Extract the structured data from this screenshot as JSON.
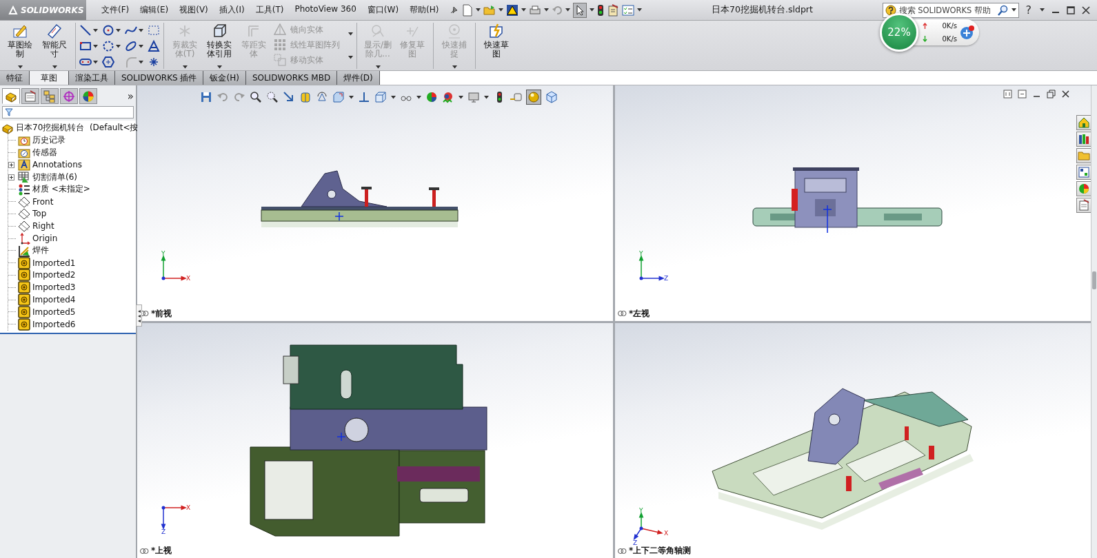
{
  "window": {
    "title": "日本70挖掘机转台.sldprt"
  },
  "app": {
    "name": "SOLIDWORKS"
  },
  "menu": [
    "文件(F)",
    "编辑(E)",
    "视图(V)",
    "插入(I)",
    "工具(T)",
    "PhotoView 360",
    "窗口(W)",
    "帮助(H)"
  ],
  "search": {
    "placeholder": "搜索 SOLIDWORKS 帮助"
  },
  "help": "?",
  "net_monitor": {
    "percent": "22%",
    "upload": "0K/s",
    "download": "0K/s"
  },
  "ribbon": [
    {
      "kind": "big",
      "label": "草图绘制",
      "disabled": false,
      "dropdown": true
    },
    {
      "kind": "big",
      "label": "智能尺寸",
      "disabled": false,
      "dropdown": true
    },
    {
      "kind": "separator"
    },
    {
      "kind": "tools"
    },
    {
      "kind": "separator"
    },
    {
      "kind": "big",
      "label": "剪裁实体(T)",
      "disabled": true,
      "dropdown": true
    },
    {
      "kind": "big",
      "label": "转换实体引用",
      "disabled": false,
      "dropdown": true
    },
    {
      "kind": "big",
      "label": "等距实体",
      "disabled": true,
      "dropdown": false
    },
    {
      "kind": "list",
      "items": [
        {
          "label": "镜向实体",
          "disabled": true
        },
        {
          "label": "线性草图阵列",
          "disabled": true
        },
        {
          "label": "移动实体",
          "disabled": true
        }
      ]
    },
    {
      "kind": "separator"
    },
    {
      "kind": "big",
      "label": "显示/删除几...",
      "disabled": true,
      "dropdown": true
    },
    {
      "kind": "big",
      "label": "修复草图",
      "disabled": true,
      "dropdown": false
    },
    {
      "kind": "separator"
    },
    {
      "kind": "big",
      "label": "快速捕捉",
      "disabled": true,
      "dropdown": true
    },
    {
      "kind": "separator"
    },
    {
      "kind": "big",
      "label": "快速草图",
      "disabled": false,
      "dropdown": false
    }
  ],
  "tabs": [
    {
      "label": "特征",
      "selected": false
    },
    {
      "label": "草图",
      "selected": true
    },
    {
      "label": "渲染工具",
      "selected": false
    },
    {
      "label": "SOLIDWORKS 插件",
      "selected": false
    },
    {
      "label": "钣金(H)",
      "selected": false
    },
    {
      "label": "SOLIDWORKS MBD",
      "selected": false
    },
    {
      "label": "焊件(D)",
      "selected": false
    }
  ],
  "feature_manager": {
    "panel_tabs": [
      {
        "selected": true
      },
      {
        "selected": false
      },
      {
        "selected": false
      },
      {
        "selected": false
      },
      {
        "selected": false
      }
    ],
    "more": "»",
    "tree": {
      "label": "日本70挖掘机转台  (Default<按",
      "kind": "part",
      "children": [
        {
          "label": "历史记录",
          "kind": "history"
        },
        {
          "label": "传感器",
          "kind": "sensors"
        },
        {
          "label": "Annotations",
          "kind": "annotations",
          "expanded": false
        },
        {
          "label": "切割清单(6)",
          "kind": "cutlist",
          "expanded": false
        },
        {
          "label": "材质 <未指定>",
          "kind": "material"
        },
        {
          "label": "Front",
          "kind": "plane"
        },
        {
          "label": "Top",
          "kind": "plane"
        },
        {
          "label": "Right",
          "kind": "plane"
        },
        {
          "label": "Origin",
          "kind": "origin"
        },
        {
          "label": "焊件",
          "kind": "weldment"
        },
        {
          "label": "Imported1",
          "kind": "body"
        },
        {
          "label": "Imported2",
          "kind": "body"
        },
        {
          "label": "Imported3",
          "kind": "body"
        },
        {
          "label": "Imported4",
          "kind": "body"
        },
        {
          "label": "Imported5",
          "kind": "body"
        },
        {
          "label": "Imported6",
          "kind": "body"
        }
      ]
    }
  },
  "viewports": [
    {
      "label": "*前视",
      "kind": "front",
      "axes": [
        "Y",
        "X"
      ]
    },
    {
      "label": "*左视",
      "kind": "left",
      "axes": [
        "Y",
        "Z"
      ]
    },
    {
      "label": "*上视",
      "kind": "top",
      "axes": [
        "X",
        "Z"
      ]
    },
    {
      "label": "*上下二等角轴测",
      "kind": "iso",
      "axes": [
        "Y",
        "X",
        "Z"
      ]
    }
  ]
}
